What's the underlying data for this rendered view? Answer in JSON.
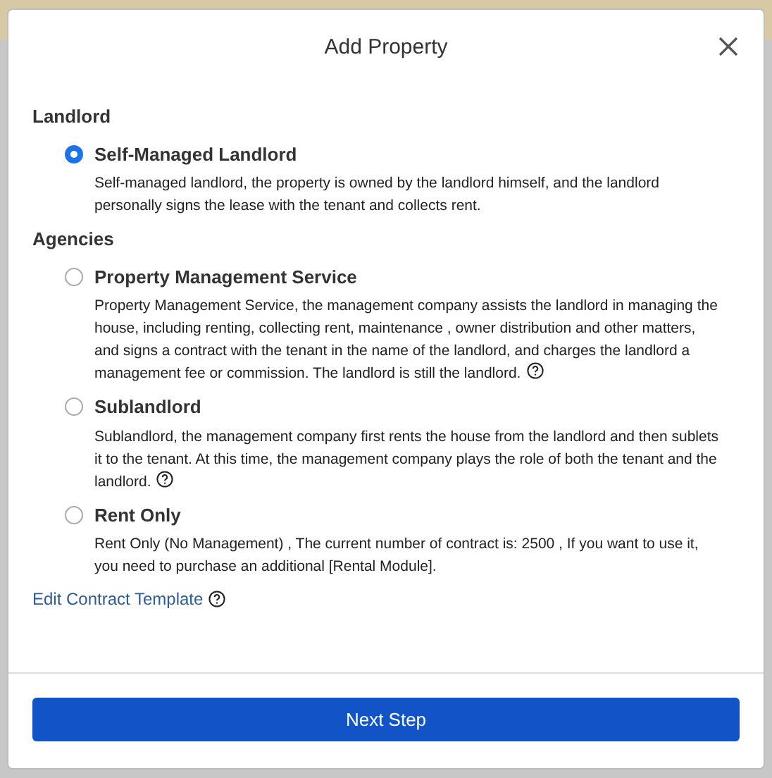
{
  "dialog": {
    "title": "Add Property"
  },
  "groups": [
    {
      "label": "Landlord",
      "options": [
        {
          "title": "Self-Managed Landlord",
          "description": "Self-managed landlord, the property is owned by the landlord himself, and the landlord personally signs the lease with the tenant and collects rent.",
          "help": false,
          "selected": true
        }
      ]
    },
    {
      "label": "Agencies",
      "options": [
        {
          "title": "Property Management Service",
          "description": "Property Management Service, the management company assists the landlord in managing the house, including renting, collecting rent, maintenance , owner distribution and other matters, and signs a contract with the tenant in the name of the landlord, and charges the landlord a management fee or commission. The landlord is still the landlord.",
          "help": true,
          "selected": false
        },
        {
          "title": "Sublandlord",
          "description": "Sublandlord, the management company first rents the house from the landlord and then sublets it to the tenant. At this time, the management company plays the role of both the tenant and the landlord.",
          "help": true,
          "selected": false
        },
        {
          "title": "Rent Only",
          "description": "Rent Only (No Management) , The current number of contract is: 2500 , If you want to use it, you need to purchase an additional [Rental Module].",
          "help": false,
          "selected": false
        }
      ]
    }
  ],
  "link": {
    "label": "Edit Contract Template",
    "help": true
  },
  "primary_button": "Next Step"
}
